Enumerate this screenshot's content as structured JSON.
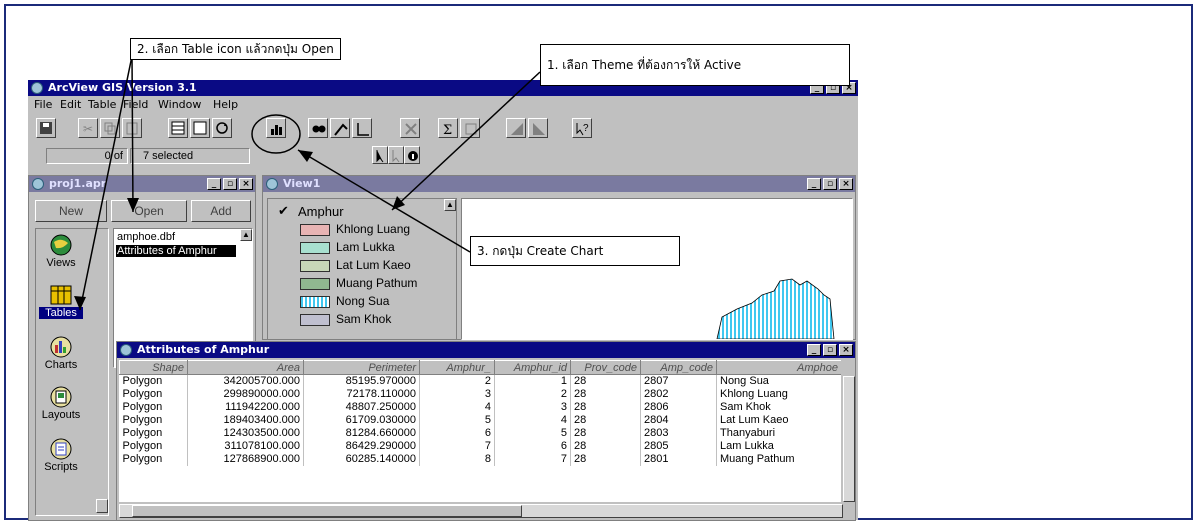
{
  "app": {
    "title": "ArcView GIS Version 3.1",
    "menus": [
      "File",
      "Edit",
      "Table",
      "Field",
      "Window",
      "Help"
    ],
    "status": {
      "count_left": "0 of",
      "count_right": "7 selected"
    }
  },
  "annotations": {
    "step1": "1. เลือก Theme ที่ต้องการให้ Active",
    "step2": "2. เลือก Table icon แล้วกดปุ่ม Open",
    "step3": "3. กดปุ่ม Create Chart"
  },
  "project": {
    "title": "proj1.apr",
    "buttons": {
      "new": "New",
      "open": "Open",
      "add": "Add"
    },
    "doc_types": [
      "Views",
      "Tables",
      "Charts",
      "Layouts",
      "Scripts"
    ],
    "selected_doc_type": "Tables",
    "table_docs": [
      "amphoe.dbf",
      "Attributes of Amphur"
    ],
    "selected_table_doc": "Attributes of Amphur"
  },
  "view": {
    "title": "View1",
    "theme_name": "Amphur",
    "theme_checked": true,
    "legend": [
      {
        "label": "Khlong Luang",
        "color": "#e8b4b4"
      },
      {
        "label": "Lam Lukka",
        "color": "#a8e0d0"
      },
      {
        "label": "Lat Lum Kaeo",
        "color": "#c8d8b8"
      },
      {
        "label": "Muang Pathum",
        "color": "#90b890"
      },
      {
        "label": "Nong Sua",
        "color": "#40c8f0"
      },
      {
        "label": "Sam Khok",
        "color": "#c0c0d0"
      }
    ]
  },
  "attributes": {
    "title": "Attributes of Amphur",
    "columns": [
      "Shape",
      "Area",
      "Perimeter",
      "Amphur_",
      "Amphur_id",
      "Prov_code",
      "Amp_code",
      "Amphoe"
    ],
    "rows": [
      [
        "Polygon",
        "342005700.000",
        "85195.970000",
        "2",
        "1",
        "28",
        "2807",
        "Nong Sua"
      ],
      [
        "Polygon",
        "299890000.000",
        "72178.110000",
        "3",
        "2",
        "28",
        "2802",
        "Khlong Luang"
      ],
      [
        "Polygon",
        "111942200.000",
        "48807.250000",
        "4",
        "3",
        "28",
        "2806",
        "Sam Khok"
      ],
      [
        "Polygon",
        "189403400.000",
        "61709.030000",
        "5",
        "4",
        "28",
        "2804",
        "Lat Lum Kaeo"
      ],
      [
        "Polygon",
        "124303500.000",
        "81284.660000",
        "6",
        "5",
        "28",
        "2803",
        "Thanyaburi"
      ],
      [
        "Polygon",
        "311078100.000",
        "86429.290000",
        "7",
        "6",
        "28",
        "2805",
        "Lam Lukka"
      ],
      [
        "Polygon",
        "127868900.000",
        "60285.140000",
        "8",
        "7",
        "28",
        "2801",
        "Muang Pathum"
      ]
    ]
  }
}
